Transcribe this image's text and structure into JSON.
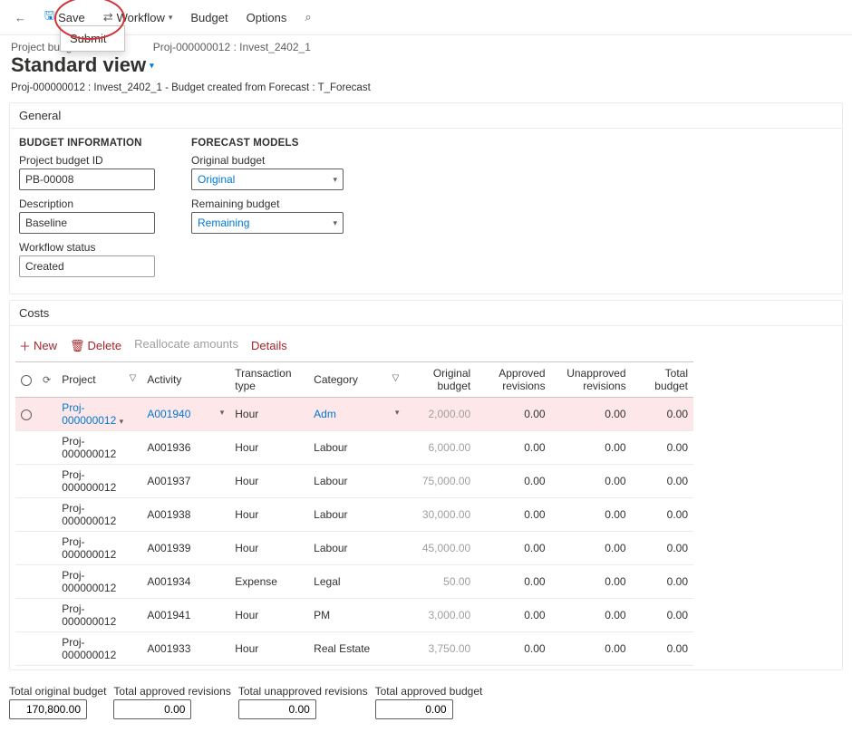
{
  "toolbar": {
    "save": "Save",
    "workflow": "Workflow",
    "submit": "Submit",
    "budget": "Budget",
    "options": "Options"
  },
  "breadcrumb": "Project budgets",
  "breadcrumb_proj": "Proj-000000012 : Invest_2402_1",
  "page_title": "Standard view",
  "subtitle": "Proj-000000012 : Invest_2402_1 - Budget created from Forecast : T_Forecast",
  "sections": {
    "general": "General",
    "costs": "Costs"
  },
  "budget_info": {
    "heading": "BUDGET INFORMATION",
    "id_label": "Project budget ID",
    "id_value": "PB-00008",
    "desc_label": "Description",
    "desc_value": "Baseline",
    "wf_label": "Workflow status",
    "wf_value": "Created"
  },
  "forecast_models": {
    "heading": "FORECAST MODELS",
    "orig_label": "Original budget",
    "orig_value": "Original",
    "rem_label": "Remaining budget",
    "rem_value": "Remaining"
  },
  "costs_toolbar": {
    "new": "New",
    "delete": "Delete",
    "reallocate": "Reallocate amounts",
    "details": "Details"
  },
  "cols": {
    "project": "Project",
    "activity": "Activity",
    "txn": "Transaction type",
    "category": "Category",
    "orig": "Original budget",
    "appr": "Approved revisions",
    "unappr": "Unapproved revisions",
    "total": "Total budget"
  },
  "rows": [
    {
      "project": "Proj-000000012",
      "activity": "A001940",
      "txn": "Hour",
      "category": "Adm",
      "orig": "2,000.00",
      "appr": "0.00",
      "unappr": "0.00",
      "total": "0.00",
      "sel": true
    },
    {
      "project": "Proj-000000012",
      "activity": "A001936",
      "txn": "Hour",
      "category": "Labour",
      "orig": "6,000.00",
      "appr": "0.00",
      "unappr": "0.00",
      "total": "0.00"
    },
    {
      "project": "Proj-000000012",
      "activity": "A001937",
      "txn": "Hour",
      "category": "Labour",
      "orig": "75,000.00",
      "appr": "0.00",
      "unappr": "0.00",
      "total": "0.00"
    },
    {
      "project": "Proj-000000012",
      "activity": "A001938",
      "txn": "Hour",
      "category": "Labour",
      "orig": "30,000.00",
      "appr": "0.00",
      "unappr": "0.00",
      "total": "0.00"
    },
    {
      "project": "Proj-000000012",
      "activity": "A001939",
      "txn": "Hour",
      "category": "Labour",
      "orig": "45,000.00",
      "appr": "0.00",
      "unappr": "0.00",
      "total": "0.00"
    },
    {
      "project": "Proj-000000012",
      "activity": "A001934",
      "txn": "Expense",
      "category": "Legal",
      "orig": "50.00",
      "appr": "0.00",
      "unappr": "0.00",
      "total": "0.00"
    },
    {
      "project": "Proj-000000012",
      "activity": "A001941",
      "txn": "Hour",
      "category": "PM",
      "orig": "3,000.00",
      "appr": "0.00",
      "unappr": "0.00",
      "total": "0.00"
    },
    {
      "project": "Proj-000000012",
      "activity": "A001933",
      "txn": "Hour",
      "category": "Real Estate",
      "orig": "3,750.00",
      "appr": "0.00",
      "unappr": "0.00",
      "total": "0.00"
    }
  ],
  "totals": {
    "orig_label": "Total original budget",
    "orig_value": "170,800.00",
    "appr_label": "Total approved revisions",
    "appr_value": "0.00",
    "unappr_label": "Total unapproved revisions",
    "unappr_value": "0.00",
    "total_label": "Total approved budget",
    "total_value": "0.00"
  }
}
